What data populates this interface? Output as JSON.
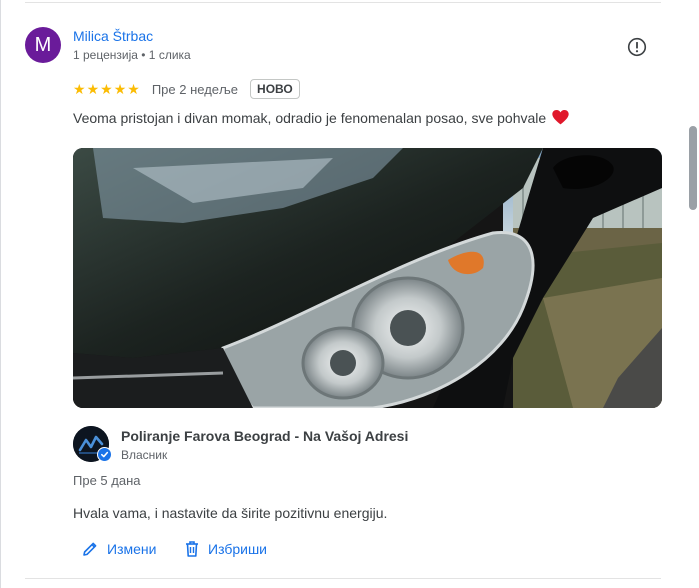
{
  "review": {
    "avatar_letter": "M",
    "reviewer_name": "Milica Štrbac",
    "reviewer_meta": "1 рецензија • 1 слика",
    "rating": 5,
    "date": "Пре 2 недеље",
    "badge": "НОВО",
    "text": "Veoma pristojan i divan momak, odradio je fenomenalan posao, sve pohvale",
    "emoji": "❤️"
  },
  "owner_response": {
    "name": "Poliranje Farova Beograd - Na Vašoj Adresi",
    "role": "Власник",
    "date": "Пре 5 дана",
    "text": "Hvala vama, i nastavite da širite pozitivnu energiju."
  },
  "actions": {
    "edit_label": "Измени",
    "delete_label": "Избриши"
  },
  "colors": {
    "link": "#1a73e8",
    "star": "#fbbc04",
    "avatar": "#6a1b9a"
  },
  "icons": [
    "flag-icon",
    "star-icon",
    "heart-emoji",
    "verified-badge-icon",
    "pencil-icon",
    "trash-icon"
  ]
}
